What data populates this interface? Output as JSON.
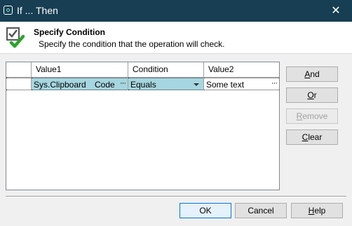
{
  "window": {
    "title": "If ... Then",
    "close_label": "✕"
  },
  "header": {
    "title": "Specify Condition",
    "subtitle": "Specify the condition that the operation will check."
  },
  "grid": {
    "columns": [
      "",
      "Value1",
      "Condition",
      "Value2"
    ],
    "rows": [
      {
        "value1": "Sys.Clipboard",
        "value1_type": "Code",
        "value1_ellipsis": "···",
        "condition": "Equals",
        "value2": "Some text",
        "value2_ellipsis": "···"
      }
    ]
  },
  "side_buttons": {
    "and": {
      "accel": "A",
      "rest": "nd"
    },
    "or": {
      "accel": "O",
      "rest": "r"
    },
    "remove": {
      "accel": "R",
      "rest": "emove"
    },
    "clear": {
      "accel": "C",
      "rest": "lear"
    }
  },
  "footer_buttons": {
    "ok": "OK",
    "cancel": "Cancel",
    "help": {
      "accel": "H",
      "rest": "elp"
    }
  },
  "colors": {
    "titlebar": "#173e52",
    "selection": "#a6d6e0",
    "check_green": "#2aa52a"
  }
}
